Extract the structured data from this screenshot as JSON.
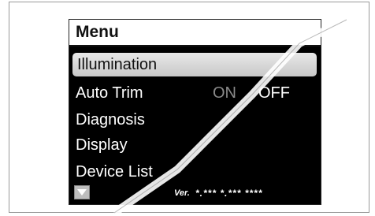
{
  "menu": {
    "title": "Menu",
    "items": [
      {
        "label": "Illumination"
      },
      {
        "label": "Auto Trim"
      },
      {
        "label": "Diagnosis"
      },
      {
        "label": "Display"
      },
      {
        "label": "Device List"
      }
    ],
    "auto_trim_on": "ON",
    "auto_trim_off": "OFF"
  },
  "footer": {
    "arrow_icon": "down-arrow-icon",
    "version_label": "Ver.",
    "version_value": "*.*** *.*** ****"
  },
  "colors": {
    "screen_bg": "#000000",
    "text": "#ffffff",
    "selection": "#d0d0d0"
  }
}
